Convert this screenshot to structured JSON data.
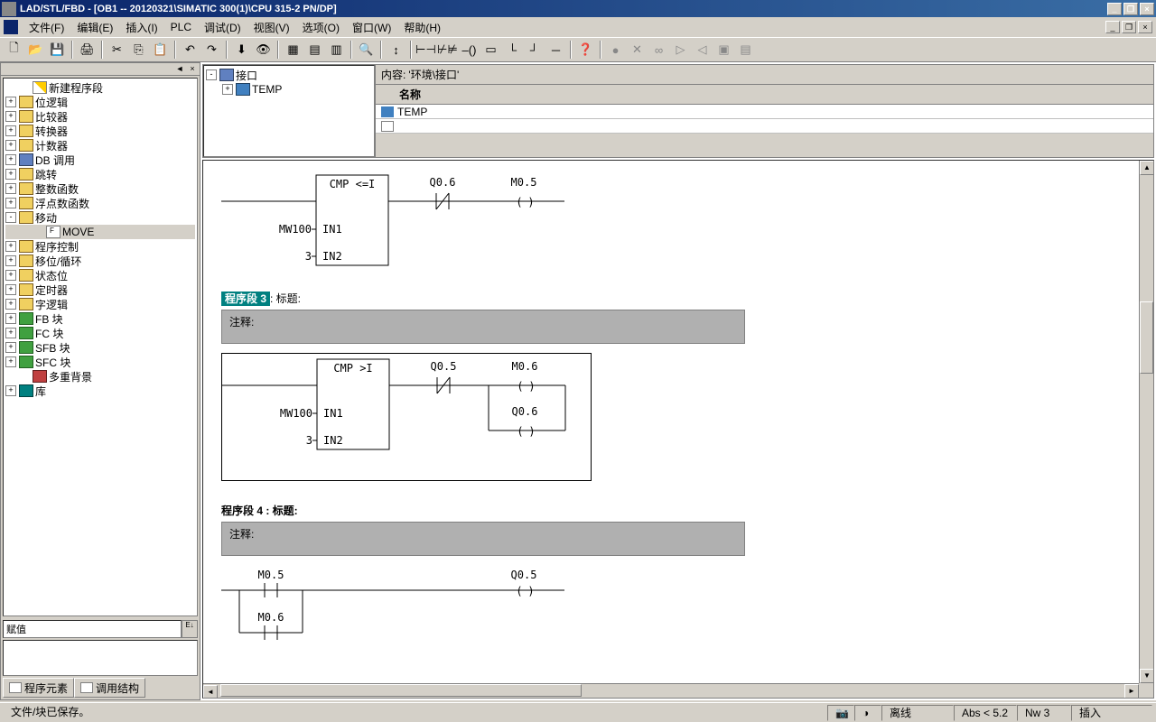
{
  "title": "LAD/STL/FBD  - [OB1 -- 20120321\\SIMATIC 300(1)\\CPU 315-2 PN/DP]",
  "menu": {
    "file": "文件(F)",
    "edit": "编辑(E)",
    "insert": "插入(I)",
    "plc": "PLC",
    "debug": "调试(D)",
    "view": "视图(V)",
    "options": "选项(O)",
    "window": "窗口(W)",
    "help": "帮助(H)"
  },
  "tree": {
    "items": [
      {
        "label": "新建程序段",
        "icon": "icon-new",
        "indent": 1,
        "expand": ""
      },
      {
        "label": "位逻辑",
        "icon": "icon-folder",
        "indent": 0,
        "expand": "+"
      },
      {
        "label": "比较器",
        "icon": "icon-folder",
        "indent": 0,
        "expand": "+"
      },
      {
        "label": "转换器",
        "icon": "icon-folder",
        "indent": 0,
        "expand": "+"
      },
      {
        "label": "计数器",
        "icon": "icon-folder",
        "indent": 0,
        "expand": "+"
      },
      {
        "label": "DB 调用",
        "icon": "icon-db",
        "indent": 0,
        "expand": "+"
      },
      {
        "label": "跳转",
        "icon": "icon-folder",
        "indent": 0,
        "expand": "+"
      },
      {
        "label": "整数函数",
        "icon": "icon-folder",
        "indent": 0,
        "expand": "+"
      },
      {
        "label": "浮点数函数",
        "icon": "icon-folder",
        "indent": 0,
        "expand": "+"
      },
      {
        "label": "移动",
        "icon": "icon-folder",
        "indent": 0,
        "expand": "-"
      },
      {
        "label": "MOVE",
        "icon": "icon-move",
        "indent": 2,
        "expand": "",
        "selected": true
      },
      {
        "label": "程序控制",
        "icon": "icon-folder",
        "indent": 0,
        "expand": "+"
      },
      {
        "label": "移位/循环",
        "icon": "icon-folder",
        "indent": 0,
        "expand": "+"
      },
      {
        "label": "状态位",
        "icon": "icon-folder",
        "indent": 0,
        "expand": "+"
      },
      {
        "label": "定时器",
        "icon": "icon-folder",
        "indent": 0,
        "expand": "+"
      },
      {
        "label": "字逻辑",
        "icon": "icon-folder",
        "indent": 0,
        "expand": "+"
      },
      {
        "label": "FB 块",
        "icon": "icon-fb",
        "indent": 0,
        "expand": "+"
      },
      {
        "label": "FC 块",
        "icon": "icon-fb",
        "indent": 0,
        "expand": "+"
      },
      {
        "label": "SFB 块",
        "icon": "icon-fb",
        "indent": 0,
        "expand": "+"
      },
      {
        "label": "SFC 块",
        "icon": "icon-fb",
        "indent": 0,
        "expand": "+"
      },
      {
        "label": "多重背景",
        "icon": "icon-lib",
        "indent": 1,
        "expand": ""
      },
      {
        "label": "库",
        "icon": "icon-book",
        "indent": 0,
        "expand": "+"
      }
    ]
  },
  "input_label": "赋值",
  "tabs": {
    "elements": "程序元素",
    "call": "调用结构"
  },
  "interface": {
    "root": "接口",
    "temp": "TEMP",
    "content_label": "内容:",
    "content_path": "'环境\\接口'",
    "col_name": "名称",
    "row_temp": "TEMP"
  },
  "networks": {
    "n2": {
      "cmp": "CMP <=I",
      "in1_val": "MW100",
      "in1": "IN1",
      "in2_val": "3",
      "in2": "IN2",
      "out1": "Q0.6",
      "out2": "M0.5"
    },
    "n3": {
      "title_hl": "程序段  3",
      "title_rest": ": 标题:",
      "comment": "注释:",
      "cmp": "CMP >I",
      "in1_val": "MW100",
      "in1": "IN1",
      "in2_val": "3",
      "in2": "IN2",
      "out1": "Q0.5",
      "out2": "M0.6",
      "out3": "Q0.6"
    },
    "n4": {
      "title": "程序段  4 : 标题:",
      "comment": "注释:",
      "c1": "M0.5",
      "c2": "M0.6",
      "out": "Q0.5"
    }
  },
  "status": {
    "main": "文件/块已保存。",
    "offline": "离线",
    "abs": "Abs < 5.2",
    "nw": "Nw 3",
    "insert": "插入"
  }
}
